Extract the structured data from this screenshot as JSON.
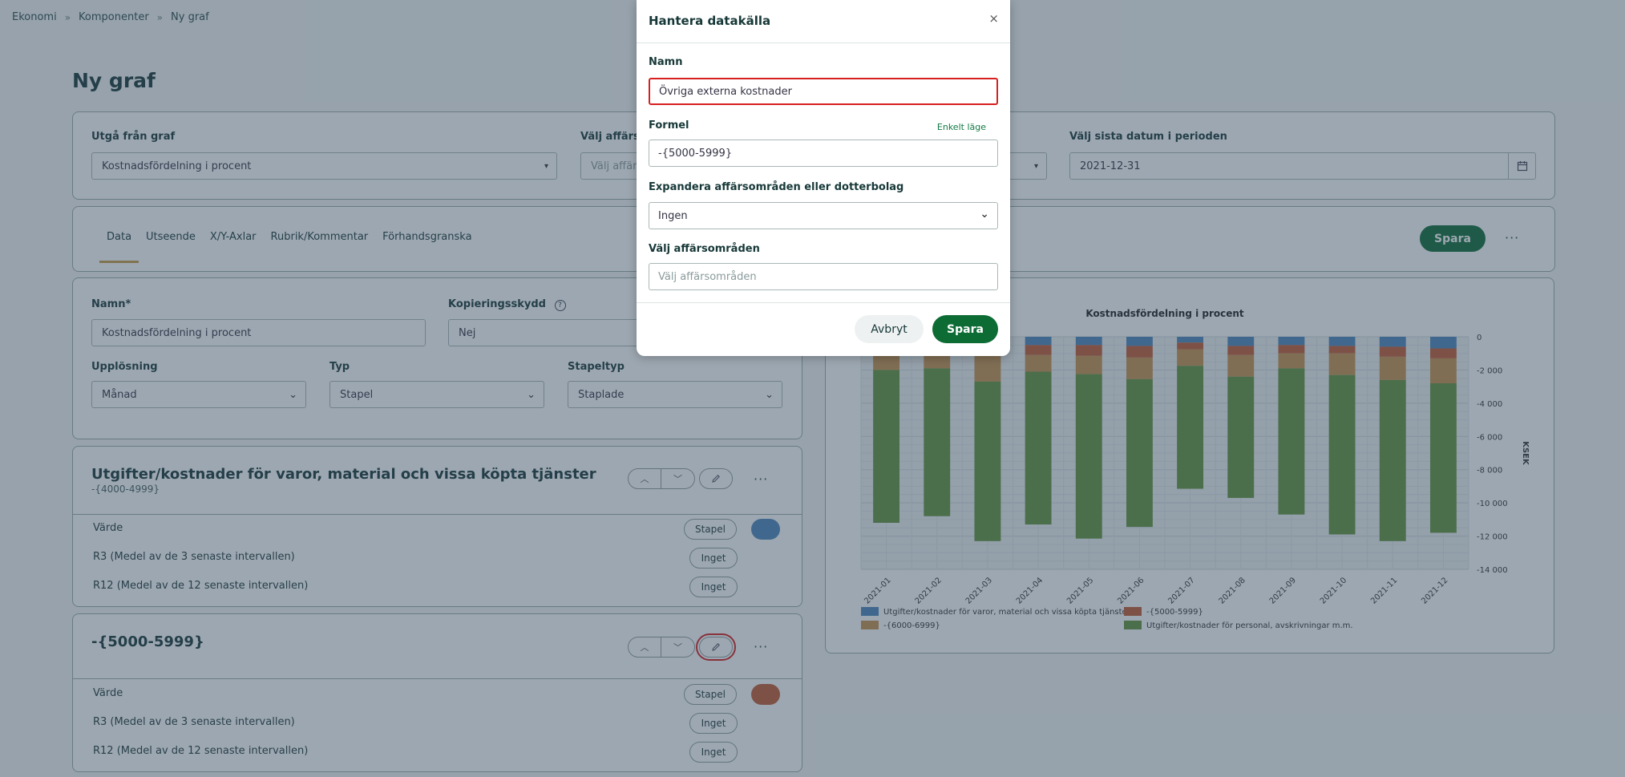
{
  "breadcrumb": [
    "Ekonomi",
    "Komponenter",
    "Ny graf"
  ],
  "page_title": "Ny graf",
  "source": {
    "base_graph_label": "Utgå från graf",
    "base_graph_value": "Kostnadsfördelning i procent",
    "business_area_label": "Välj affärso",
    "business_area_placeholder": "Välj affärs",
    "last_date_label": "Välj sista datum i perioden",
    "last_date_value": "2021-12-31"
  },
  "tabs": [
    "Data",
    "Utseende",
    "X/Y-Axlar",
    "Rubrik/Kommentar",
    "Förhandsgranska"
  ],
  "toolbar": {
    "save": "Spara",
    "more": "···"
  },
  "settings": {
    "name_label": "Namn*",
    "name_value": "Kostnadsfördelning i procent",
    "copy_label": "Kopieringsskydd",
    "copy_value": "Nej",
    "resolution_label": "Upplösning",
    "resolution_value": "Månad",
    "type_label": "Typ",
    "type_value": "Stapel",
    "bartype_label": "Stapeltyp",
    "bartype_value": "Staplade"
  },
  "datasources": [
    {
      "title": "Utgifter/kostnader för varor, material och vissa köpta tjänster",
      "formula": "-{4000-4999}",
      "rows": [
        {
          "label": "Värde",
          "pill": "Stapel"
        },
        {
          "label": "R3 (Medel av de 3 senaste intervallen)",
          "pill": "Inget"
        },
        {
          "label": "R12 (Medel av de 12 senaste intervallen)",
          "pill": "Inget"
        }
      ],
      "color": "#4e86bd"
    },
    {
      "title": "-{5000-5999}",
      "formula": "",
      "rows": [
        {
          "label": "Värde",
          "pill": "Stapel"
        },
        {
          "label": "R3 (Medel av de 3 senaste intervallen)",
          "pill": "Inget"
        },
        {
          "label": "R12 (Medel av de 12 senaste intervallen)",
          "pill": "Inget"
        }
      ],
      "color": "#c45a35"
    }
  ],
  "modal": {
    "title": "Hantera datakälla",
    "close": "×",
    "name_label": "Namn",
    "name_value": "Övriga externa kostnader",
    "formula_label": "Formel",
    "formula_mode_link": "Enkelt läge",
    "formula_value": "-{5000-5999}",
    "expand_label": "Expandera affärsområden eller dotterbolag",
    "expand_value": "Ingen",
    "areas_label": "Välj affärsområden",
    "areas_placeholder": "Välj affärsområden",
    "cancel": "Avbryt",
    "save": "Spara"
  },
  "chart_data": {
    "type": "bar",
    "stacked": true,
    "title": "Kostnadsfördelning i procent",
    "ylabel": "KSEK",
    "ylim": [
      -14000,
      0
    ],
    "yticks": [
      0,
      -2000,
      -4000,
      -6000,
      -8000,
      -10000,
      -12000,
      -14000
    ],
    "ytick_labels": [
      "0",
      "-2 000",
      "-4 000",
      "-6 000",
      "-8 000",
      "-10 000",
      "-12 000",
      "-14 000"
    ],
    "categories": [
      "2021-01",
      "2021-02",
      "2021-03",
      "2021-04",
      "2021-05",
      "2021-06",
      "2021-07",
      "2021-08",
      "2021-09",
      "2021-10",
      "2021-11",
      "2021-12"
    ],
    "legend_position": "bottom",
    "series": [
      {
        "name": "Utgifter/kostnader för varor, material och vissa köpta tjänster",
        "color": "#4e86bd",
        "values": [
          -400,
          -300,
          -450,
          -500,
          -500,
          -550,
          -350,
          -550,
          -500,
          -550,
          -600,
          -700
        ]
      },
      {
        "name": "-{5000-5999}",
        "color": "#c45a35",
        "values": [
          -300,
          -400,
          -450,
          -600,
          -650,
          -700,
          -400,
          -550,
          -500,
          -450,
          -600,
          -600
        ]
      },
      {
        "name": "-{6000-6999}",
        "color": "#c8924e",
        "values": [
          -1300,
          -1200,
          -1800,
          -1000,
          -1100,
          -1300,
          -1000,
          -1300,
          -900,
          -1300,
          -1400,
          -1500
        ]
      },
      {
        "name": "Utgifter/kostnader för personal, avskrivningar m.m.",
        "color": "#62933d",
        "values": [
          -9200,
          -8900,
          -9600,
          -9200,
          -9900,
          -8900,
          -7400,
          -7300,
          -8800,
          -9600,
          -9700,
          -9000
        ]
      }
    ]
  }
}
